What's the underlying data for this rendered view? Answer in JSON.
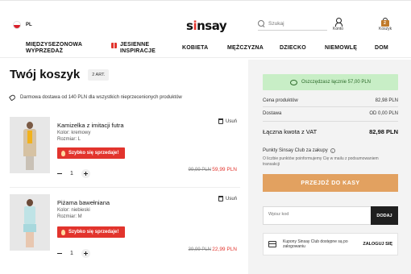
{
  "header": {
    "language": "PL",
    "logo": "sinsay",
    "search_placeholder": "Szukaj",
    "account_label": "Konto",
    "cart_label": "Koszyk",
    "cart_count": "2"
  },
  "nav": {
    "items": [
      {
        "label": "MIĘDZYSEZONOWA WYPRZEDAŻ"
      },
      {
        "label": "JESIENNE INSPIRACJE"
      },
      {
        "label": "KOBIETA"
      },
      {
        "label": "MĘŻCZYZNA"
      },
      {
        "label": "DZIECKO"
      },
      {
        "label": "NIEMOWLĘ"
      },
      {
        "label": "DOM"
      }
    ]
  },
  "cart": {
    "title": "Twój koszyk",
    "count_badge": "2 ART.",
    "free_shipping": "Darmowa dostawa od 140 PLN dla wszystkich nieprzecenionych produktów",
    "items": [
      {
        "name": "Kamizelka z imitacji futra",
        "color": "Kolor: kremowy",
        "size": "Rozmiar: L",
        "hot_label": "Szybko się sprzedaje!",
        "remove_label": "Usuń",
        "quantity": "1",
        "old_price": "99,99 PLN",
        "new_price": "59,99 PLN"
      },
      {
        "name": "Piżama bawełniana",
        "color": "Kolor: niebieski",
        "size": "Rozmiar: M",
        "hot_label": "Szybko się sprzedaje!",
        "remove_label": "Usuń",
        "quantity": "1",
        "old_price": "39,99 PLN",
        "new_price": "22,99 PLN"
      }
    ]
  },
  "summary": {
    "savings": "Oszczędzasz łącznie 57,00 PLN",
    "products_label": "Cena produktów",
    "products_value": "82,98 PLN",
    "delivery_label": "Dostawa",
    "delivery_value": "OD 0,00 PLN",
    "total_label": "Łączna kwota z VAT",
    "total_value": "82,98 PLN",
    "points_title": "Punkty Sinsay Club za zakupy",
    "points_note": "O liczbie punktów poinformujemy Cię w mailu z podsumowaniem transakcji",
    "checkout_label": "PRZEJDŹ DO KASY",
    "coupon_placeholder": "Wpisz kod",
    "apply_label": "DODAJ",
    "club_text": "Kupony Sinsay Club dostępne są po zalogowaniu",
    "login_label": "ZALOGUJ SIĘ"
  },
  "colors": {
    "accent_red": "#e2342d",
    "checkout": "#e2a160",
    "savings_bg": "#c8eec6"
  }
}
